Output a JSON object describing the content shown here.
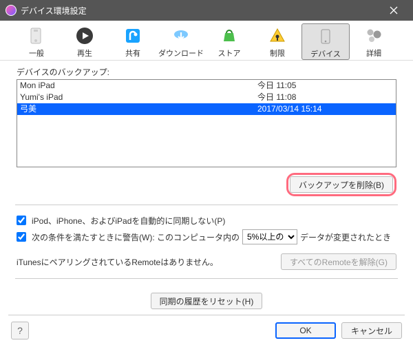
{
  "titlebar": {
    "title": "デバイス環境設定"
  },
  "toolbar": {
    "items": [
      {
        "label": "一般"
      },
      {
        "label": "再生"
      },
      {
        "label": "共有"
      },
      {
        "label": "ダウンロード"
      },
      {
        "label": "ストア"
      },
      {
        "label": "制限"
      },
      {
        "label": "デバイス"
      },
      {
        "label": "詳細"
      }
    ],
    "active_index": 6
  },
  "backups": {
    "header": "デバイスのバックアップ:",
    "rows": [
      {
        "name": "Mon iPad",
        "date": "今日 11:05",
        "selected": false
      },
      {
        "name": "Yumi's iPad",
        "date": "今日 11:08",
        "selected": false
      },
      {
        "name": "弓美",
        "date": "2017/03/14 15:14",
        "selected": true
      }
    ],
    "delete_label": "バックアップを削除(B)"
  },
  "options": {
    "prevent_sync": {
      "checked": true,
      "label": "iPod、iPhone、およびiPadを自動的に同期しない(P)"
    },
    "warn": {
      "checked": true,
      "prefix": "次の条件を満たすときに警告(W): このコンピュータ内の",
      "select_value": "5%以上の",
      "suffix": "データが変更されたとき"
    }
  },
  "remote": {
    "text": "iTunesにペアリングされているRemoteはありません。",
    "unpair_label": "すべてのRemoteを解除(G)"
  },
  "reset_history_label": "同期の履歴をリセット(H)",
  "footer": {
    "help": "?",
    "ok": "OK",
    "cancel": "キャンセル"
  }
}
